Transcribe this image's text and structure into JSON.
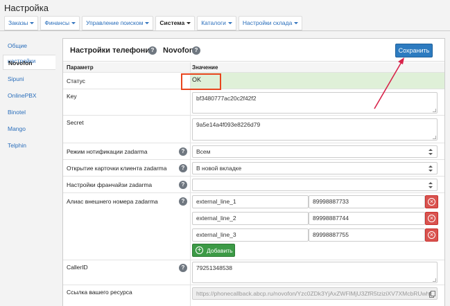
{
  "header": {
    "title": "Настройка"
  },
  "tabs": [
    {
      "label": "Заказы",
      "active": false
    },
    {
      "label": "Финансы",
      "active": false
    },
    {
      "label": "Управление поиском",
      "active": false
    },
    {
      "label": "Система",
      "active": true
    },
    {
      "label": "Каталоги",
      "active": false
    },
    {
      "label": "Настройки склада",
      "active": false
    }
  ],
  "sidebar": {
    "items": [
      {
        "label": "Общие настройки",
        "active": false
      },
      {
        "label": "Novofon",
        "active": true
      },
      {
        "label": "Sipuni",
        "active": false
      },
      {
        "label": "OnlinePBX",
        "active": false
      },
      {
        "label": "Binotel",
        "active": false
      },
      {
        "label": "Mango",
        "active": false
      },
      {
        "label": "Telphin",
        "active": false
      }
    ]
  },
  "panel": {
    "title": "Настройки телефонии",
    "provider": "Novofon",
    "save_label": "Сохранить",
    "help_glyph": "?",
    "columns": {
      "param": "Параметр",
      "value": "Значение"
    },
    "status": {
      "label": "Статус",
      "value": "OK"
    },
    "key": {
      "label": "Key",
      "value": "bf3480777ac20c2f42f2"
    },
    "secret": {
      "label": "Secret",
      "value": "9a5e14a4f093e8226d79"
    },
    "notify_mode": {
      "label": "Режим нотификации zadarma",
      "value": "Всем"
    },
    "open_card": {
      "label": "Открытие карточки клиента zadarma",
      "value": "В новой вкладке"
    },
    "franchise": {
      "label": "Настройки франчайзи zadarma",
      "value": ""
    },
    "alias": {
      "label": "Алиас внешнего номера zadarma",
      "lines": [
        {
          "name": "external_line_1",
          "number": "89998887733"
        },
        {
          "name": "external_line_2",
          "number": "89998887744"
        },
        {
          "name": "external_line_3",
          "number": "89998887755"
        }
      ],
      "add_label": "Добавить"
    },
    "callerid": {
      "label": "CallerID",
      "value": "79251348538"
    },
    "resource_link": {
      "label": "Ссылка вашего ресурса",
      "value": "https://phonecallback.abcp.ru/novofon/Yzc0ZDk3YjAxZWFlMjU3ZfR5tziziXV7XMcbRUwhb"
    }
  },
  "colors": {
    "accent": "#2d7bc0",
    "success": "#3c9a46",
    "danger": "#d9534f",
    "status_bg": "#dff0d8",
    "highlight": "#e8451e"
  }
}
